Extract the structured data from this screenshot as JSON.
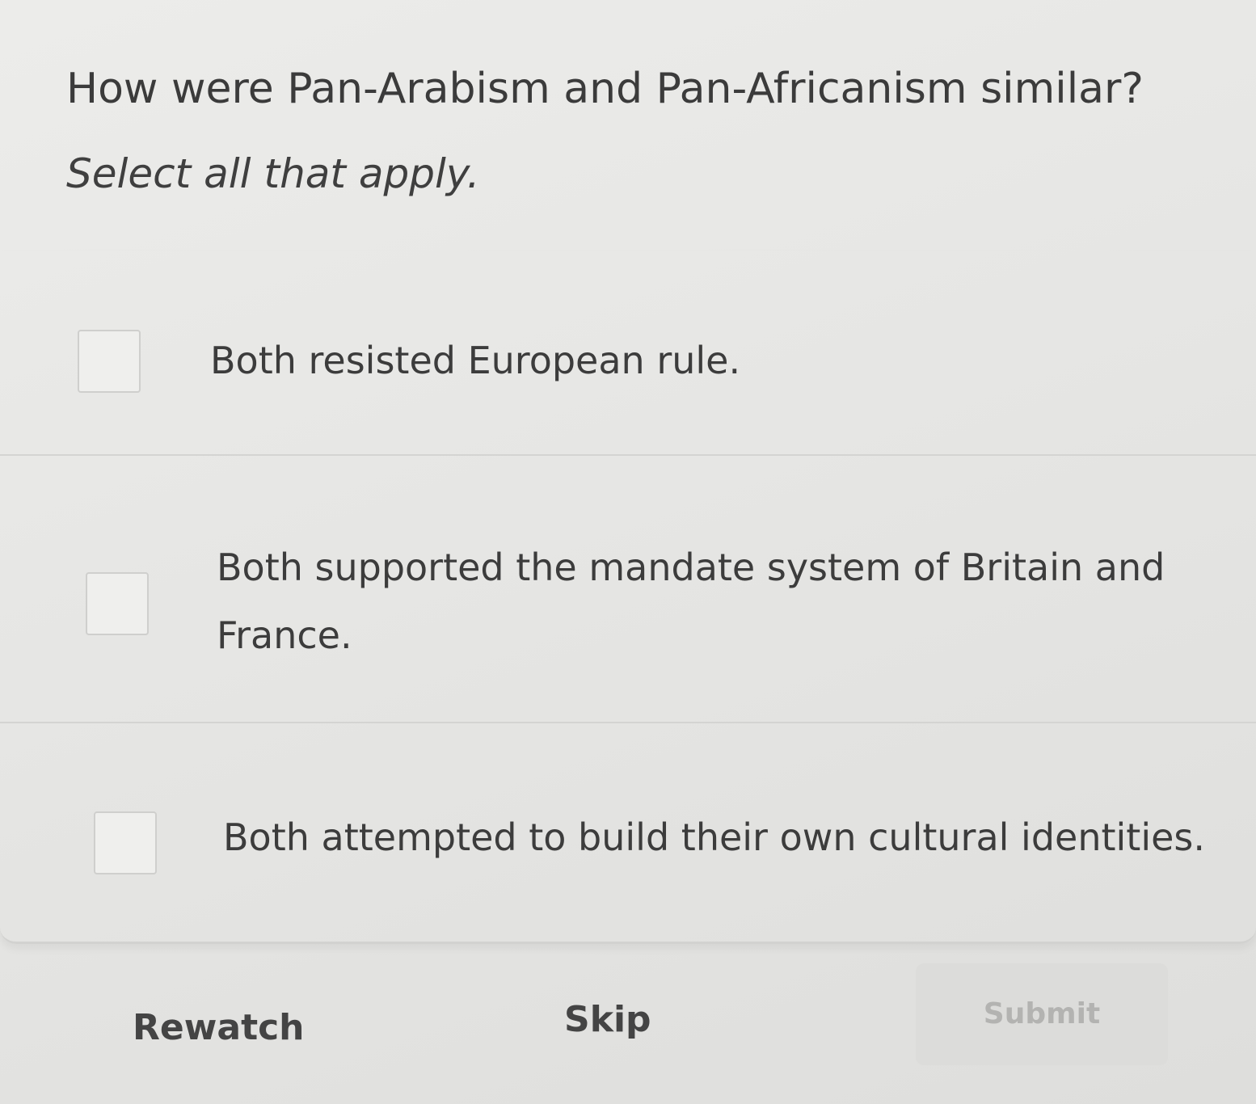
{
  "question": {
    "title": "How were Pan-Arabism and Pan-Africanism similar?",
    "hint": "Select all that apply."
  },
  "options": [
    {
      "label": "Both resisted European rule.",
      "checked": false
    },
    {
      "label_line1": "Both supported the mandate system of Britain and",
      "label_line2": "France.",
      "checked": false
    },
    {
      "label": "Both attempted to build their own cultural identities.",
      "checked": false
    }
  ],
  "footer": {
    "rewatch_label": "Rewatch",
    "skip_label": "Skip",
    "submit_label": "Submit",
    "submit_enabled": false
  },
  "colors": {
    "background": "#e6e6e4",
    "text": "#3b3b3b",
    "divider": "#d4d4d2",
    "submit_disabled_bg": "#dcdcda",
    "submit_disabled_text": "#b3b3b1"
  }
}
